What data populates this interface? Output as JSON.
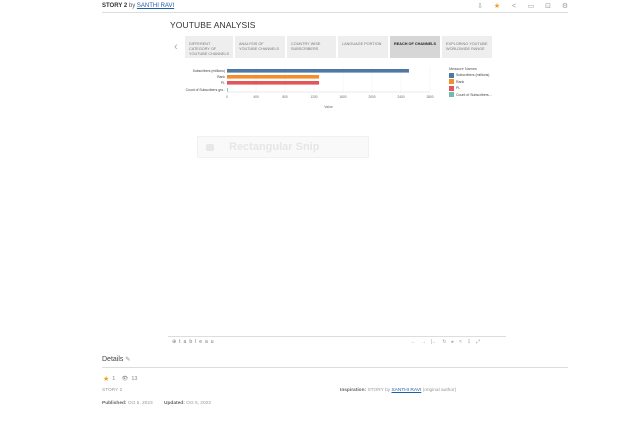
{
  "header": {
    "title": "STORY 2",
    "by": "by",
    "author": "SANTHI RAVI",
    "icons": [
      {
        "name": "download-icon",
        "glyph": "⇩"
      },
      {
        "name": "favorite-icon",
        "glyph": "★"
      },
      {
        "name": "share-icon",
        "glyph": "<"
      },
      {
        "name": "comment-icon",
        "glyph": "▭"
      },
      {
        "name": "fullscreen-icon",
        "glyph": "⊡"
      },
      {
        "name": "settings-icon",
        "glyph": "⚙"
      }
    ]
  },
  "story": {
    "title": "YOUTUBE ANALYSIS",
    "points": [
      "DIFFERENT CATEGORY OF YOUTUBE CHANNELS",
      "ANALYSIS OF YOUTUBE CHANNELS",
      "COUNTRY WISE SUBSCRIBERS",
      "LANGUAGE PORTION",
      "REACH OF CHANNELS",
      "EXPLORING YOUTUBE WORLDWIDE RANGE"
    ],
    "active_point": 4
  },
  "chart_data": {
    "type": "bar",
    "orientation": "horizontal",
    "categories": [
      "Subscribers (millions)",
      "Rank",
      "PL",
      "Count of Subscribers gro.."
    ],
    "values": [
      2510,
      1270,
      1270,
      10
    ],
    "colors": [
      "#4e79a7",
      "#f28e2b",
      "#e15759",
      "#76b7b2"
    ],
    "xlabel": "Value",
    "xticks": [
      0,
      400,
      800,
      1200,
      1600,
      2000,
      2400,
      2800
    ],
    "xlim": [
      0,
      2800
    ],
    "legend": {
      "title": "Measure Names",
      "placement": "right",
      "entries": [
        "Subscribers (millions)",
        "Rank",
        "PL",
        "Count of Subscribers..."
      ]
    }
  },
  "snip": {
    "label": "Rectangular Snip"
  },
  "toolbar": {
    "logo": "⊕ t a b l e a u",
    "icons": [
      {
        "name": "undo-icon",
        "glyph": "←"
      },
      {
        "name": "redo-icon",
        "glyph": "→"
      },
      {
        "name": "revert-icon",
        "glyph": "|←"
      },
      {
        "name": "refresh-icon",
        "glyph": "↻"
      },
      {
        "name": "pause-icon",
        "glyph": "▸"
      },
      {
        "name": "share-icon",
        "glyph": "<"
      },
      {
        "name": "download-icon",
        "glyph": "⇩"
      },
      {
        "name": "fullscreen-icon",
        "glyph": "⤢"
      }
    ]
  },
  "details": {
    "title": "Details",
    "edit_glyph": "✎",
    "favorites": "1",
    "views": "13",
    "story_label": "STORY 2",
    "inspiration_label": "Inspiration:",
    "inspiration_prefix": "STORY by",
    "inspiration_author": "SANTHI RAVI",
    "inspiration_suffix": "(original author)",
    "published_label": "Published:",
    "published_date": "Oct 5, 2023",
    "updated_label": "Updated:",
    "updated_date": "Oct 5, 2023"
  }
}
